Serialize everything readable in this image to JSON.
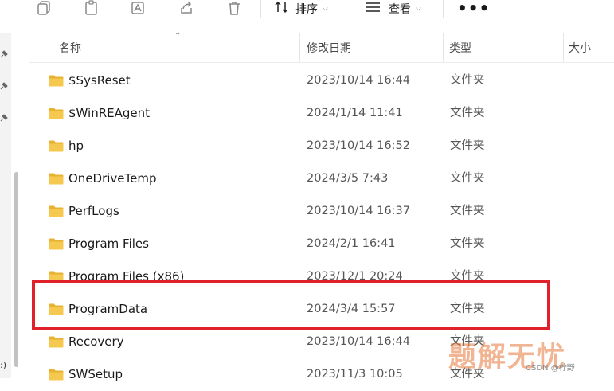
{
  "toolbar": {
    "sort_label": "排序",
    "view_label": "查看",
    "more_label": "•••",
    "icons": [
      "copy-icon",
      "paste-icon",
      "rename-icon",
      "share-icon",
      "delete-icon",
      "sort-icon",
      "view-icon",
      "more-icon"
    ]
  },
  "columns": {
    "name": "名称",
    "date": "修改日期",
    "type": "类型",
    "size": "大小"
  },
  "left_label": ":)",
  "rows": [
    {
      "name": "$SysReset",
      "date": "2023/10/14 16:44",
      "type": "文件夹"
    },
    {
      "name": "$WinREAgent",
      "date": "2024/1/14 11:41",
      "type": "文件夹"
    },
    {
      "name": "hp",
      "date": "2023/10/14 16:52",
      "type": "文件夹"
    },
    {
      "name": "OneDriveTemp",
      "date": "2024/3/5 7:43",
      "type": "文件夹"
    },
    {
      "name": "PerfLogs",
      "date": "2023/10/14 16:37",
      "type": "文件夹"
    },
    {
      "name": "Program Files",
      "date": "2024/2/1 16:41",
      "type": "文件夹"
    },
    {
      "name": "Program Files (x86)",
      "date": "2023/12/1 20:24",
      "type": "文件夹"
    },
    {
      "name": "ProgramData",
      "date": "2024/3/4 15:57",
      "type": "文件夹"
    },
    {
      "name": "Recovery",
      "date": "2023/10/14 16:44",
      "type": "文件夹"
    },
    {
      "name": "SWSetup",
      "date": "2023/11/3 10:05",
      "type": "文件夹"
    }
  ],
  "colors": {
    "folder": "#f5c84f",
    "folder_dark": "#e7b230",
    "highlight": "#e0202a"
  },
  "watermark": "题解无忧",
  "csdn_watermark": "CSDN @柠野"
}
